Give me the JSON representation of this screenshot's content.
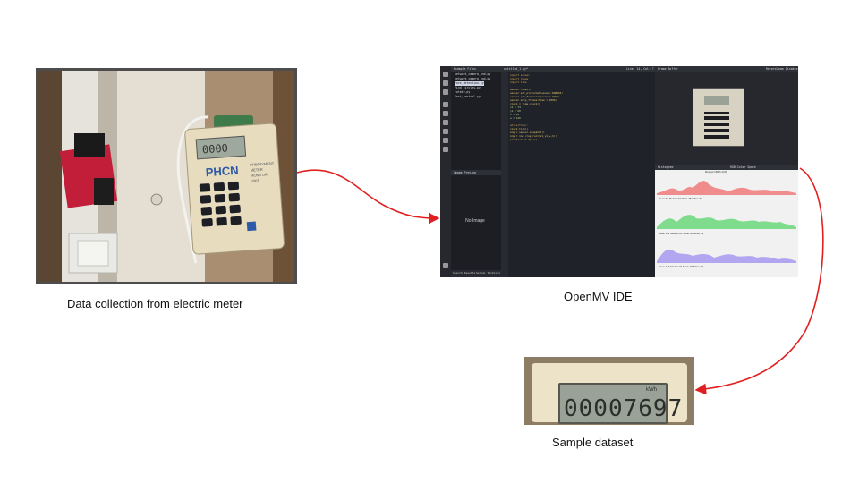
{
  "captions": {
    "meter": "Data collection from electric meter",
    "ide": "OpenMV IDE",
    "sample": "Sample dataset"
  },
  "meter_photo": {
    "brand": "PHCN",
    "label_lines": [
      "PREPAYMENT",
      "METER",
      "MONITOR",
      "UNIT"
    ]
  },
  "ide": {
    "files_header": "Example Files",
    "files": [
      "network_camera_and.py",
      "network_camera_and.py",
      "face_detection.py",
      "find_circles.py",
      "rotate.py",
      "fast_control.py"
    ],
    "editor_tab": "untitled_1.py*",
    "cursor_pos": "Line: 14, Col: 7",
    "frame_buffer_header": "Frame Buffer",
    "frame_buffer_controls": [
      "Record",
      "Zoom",
      "Disable"
    ],
    "image_preview_header": "Image Preview",
    "no_image": "No Image",
    "histogram_header": "Histogram",
    "rgb_title": "RGB Color Space",
    "resolution": "Res (w:160 h:120)",
    "stat_labels": [
      "Mean",
      "Median",
      "Mode",
      "StDev",
      "Min",
      "Max",
      "LQ",
      "UQ"
    ],
    "stats": [
      [
        "97",
        "93",
        "78",
        "63",
        "0",
        "255",
        "72",
        "116"
      ],
      [
        "122",
        "81",
        "86",
        "62",
        "4",
        "255",
        "87",
        "142"
      ],
      [
        "134",
        "94",
        "99",
        "64",
        "0",
        "255",
        "102",
        "155"
      ]
    ],
    "axis_ticks": [
      "0",
      "64",
      "128",
      "192",
      "255"
    ],
    "bottom_tabs": [
      "Search Results",
      "Serial Terminal"
    ],
    "code": [
      "import sensor",
      "import image",
      "import time",
      "",
      "sensor.reset()",
      "sensor.set_pixformat(sensor.RGB565)",
      "sensor.set_framesize(sensor.QVGA)",
      "sensor.skip_frames(time = 2000)",
      "clock = time.clock()",
      "x1 = 74",
      "y1 = 60",
      "h = 42",
      "w = 126",
      "",
      "while(True):",
      "    clock.tick()",
      "    img = sensor.snapshot()",
      "    img = img.crop(roi=(x1,y1,w,h))",
      "    print(clock.fps())"
    ]
  },
  "sample_dataset": {
    "digits": "00007697",
    "unit": "kWh"
  },
  "colors": {
    "arrow": "#e02020",
    "ide_bg": "#1c1e24",
    "hist_red": "#f08c8c",
    "hist_green": "#7fdc8c",
    "hist_blue": "#b3a6f0"
  }
}
